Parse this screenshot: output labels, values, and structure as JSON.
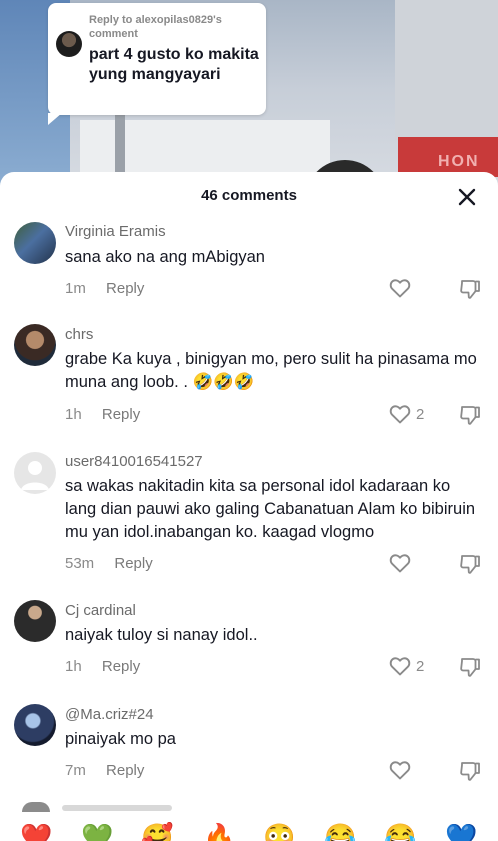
{
  "reply_sticker": {
    "reply_to": "Reply to alexopilas0829's comment",
    "text": "part 4 gusto ko makita yung mangyayari"
  },
  "video_sign_text": "HON",
  "comments_sheet": {
    "title": "46 comments",
    "reply_label": "Reply",
    "comments": [
      {
        "username": "Virginia Eramis",
        "text": "sana ako na ang mAbigyan",
        "time": "1m",
        "likes": ""
      },
      {
        "username": "chrs",
        "text": "grabe Ka kuya , binigyan mo, pero sulit ha pinasama mo muna ang loob. . 🤣🤣🤣",
        "time": "1h",
        "likes": "2"
      },
      {
        "username": "user8410016541527",
        "text": "sa wakas nakitadin kita sa personal idol kadaraan ko lang dian pauwi ako galing Cabanatuan Alam ko bibiruin mu yan idol.inabangan ko. kaagad vlogmo",
        "time": "53m",
        "likes": ""
      },
      {
        "username": "Cj cardinal",
        "text": "naiyak tuloy si nanay idol..",
        "time": "1h",
        "likes": "2"
      },
      {
        "username": "@Ma.criz#24",
        "text": "pinaiyak mo pa",
        "time": "7m",
        "likes": ""
      }
    ]
  },
  "emoji_bar": [
    "❤️",
    "💚",
    "🥰",
    "🔥",
    "😳",
    "😂",
    "😂",
    "💙"
  ],
  "colors": {
    "text": "#161823",
    "meta": "#8a8a8a",
    "background": "#ffffff"
  },
  "icons": [
    "close-icon",
    "heart-icon",
    "dislike-icon"
  ]
}
